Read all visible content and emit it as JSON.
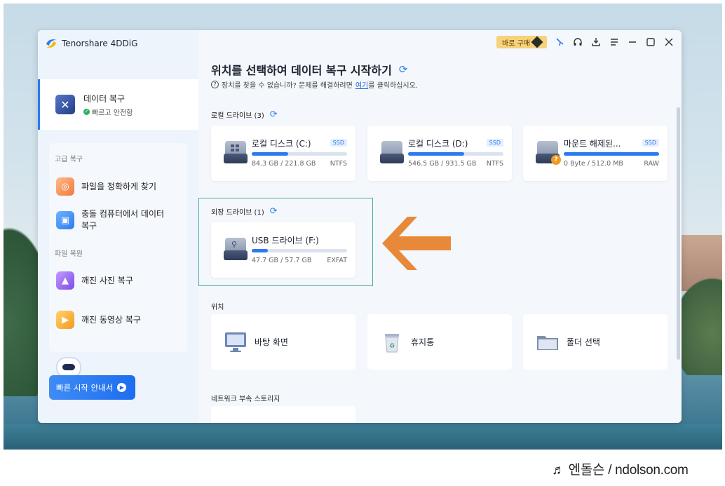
{
  "app": {
    "name": "Tenorshare 4DDiG"
  },
  "topbar": {
    "buy_label": "바로 구매"
  },
  "sidebar": {
    "active": {
      "title": "데이터 복구",
      "subtitle": "빠르고 안전함"
    },
    "sections": [
      {
        "label": "고급 복구",
        "items": [
          {
            "label": "파일을 정확하게 찾기",
            "icon": "target-file-icon"
          },
          {
            "label": "충돌 컴퓨터에서 데이터 복구",
            "icon": "crashed-pc-icon"
          }
        ]
      },
      {
        "label": "파일 복원",
        "items": [
          {
            "label": "깨진 사진 복구",
            "icon": "photo-repair-icon"
          },
          {
            "label": "깨진 동영상 복구",
            "icon": "video-repair-icon"
          }
        ]
      }
    ],
    "quick_start_label": "빠른 시작 안내서"
  },
  "main": {
    "title": "위치를 선택하여 데이터 복구 시작하기",
    "subtitle_prefix": "장치를 찾을 수 없습니까? 문제를 해결하려면",
    "subtitle_link": "여기",
    "subtitle_suffix": "를 클릭하십시오.",
    "local_section": "로컬 드라이브 (3)",
    "external_section": "외장 드라이브 (1)",
    "location_section": "위치",
    "network_section": "네트워크 부속 스토리지",
    "local_drives": [
      {
        "name": "로컬 디스크 (C:)",
        "badge": "SSD",
        "size": "84.3 GB / 221.8 GB",
        "fs": "NTFS",
        "usage": 0.38
      },
      {
        "name": "로컬 디스크 (D:)",
        "badge": "SSD",
        "size": "546.5 GB / 931.5 GB",
        "fs": "NTFS",
        "usage": 0.59
      },
      {
        "name": "마운트 해제된...",
        "badge": "SSD",
        "size": "0 Byte / 512.0 MB",
        "fs": "RAW",
        "usage": 1.0
      }
    ],
    "external_drives": [
      {
        "name": "USB 드라이브 (F:)",
        "size": "47.7 GB / 57.7 GB",
        "fs": "EXFAT",
        "usage": 0.17
      }
    ],
    "locations": [
      {
        "label": "바탕 화면",
        "icon": "desktop-monitor-icon"
      },
      {
        "label": "휴지통",
        "icon": "recycle-bin-icon"
      },
      {
        "label": "폴더 선택",
        "icon": "folder-icon"
      }
    ]
  },
  "caption": {
    "text": "♬ 엔돌슨 / ndolson.com"
  },
  "colors": {
    "accent": "#2b7bf0",
    "highlight": "#4cae9e",
    "arrow": "#e8893a"
  }
}
